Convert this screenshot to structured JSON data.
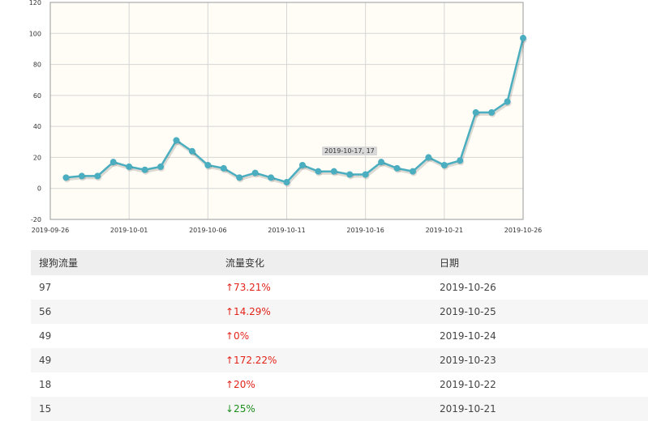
{
  "chart_data": {
    "type": "line",
    "x": [
      "2019-09-27",
      "2019-09-28",
      "2019-09-29",
      "2019-09-30",
      "2019-10-01",
      "2019-10-02",
      "2019-10-03",
      "2019-10-04",
      "2019-10-05",
      "2019-10-06",
      "2019-10-07",
      "2019-10-08",
      "2019-10-09",
      "2019-10-10",
      "2019-10-11",
      "2019-10-12",
      "2019-10-13",
      "2019-10-14",
      "2019-10-15",
      "2019-10-16",
      "2019-10-17",
      "2019-10-18",
      "2019-10-19",
      "2019-10-20",
      "2019-10-21",
      "2019-10-22",
      "2019-10-23",
      "2019-10-24",
      "2019-10-25",
      "2019-10-26"
    ],
    "series": [
      {
        "values": [
          7,
          8,
          8,
          17,
          14,
          12,
          14,
          31,
          24,
          15,
          13,
          7,
          10,
          7,
          4,
          15,
          11,
          11,
          9,
          9,
          17,
          13,
          11,
          20,
          15,
          18,
          49,
          49,
          56,
          97
        ]
      }
    ],
    "xticks": [
      "2019-09-26",
      "2019-10-01",
      "2019-10-06",
      "2019-10-11",
      "2019-10-16",
      "2019-10-21",
      "2019-10-26"
    ],
    "yticks": [
      -20,
      0,
      20,
      40,
      60,
      80,
      100,
      120
    ],
    "ylim": [
      -20,
      120
    ],
    "xlim": [
      "2019-09-26",
      "2019-10-26"
    ],
    "grid": true,
    "line_color": "#4aaec0",
    "plot_background": "#fffdf5",
    "tooltip": "2019-10-17, 17"
  },
  "table": {
    "headers": [
      "搜狗流量",
      "流量变化",
      "日期"
    ],
    "rows": [
      {
        "traffic": "97",
        "change": "↑73.21%",
        "date": "2019-10-26",
        "direction": "up"
      },
      {
        "traffic": "56",
        "change": "↑14.29%",
        "date": "2019-10-25",
        "direction": "up"
      },
      {
        "traffic": "49",
        "change": "↑0%",
        "date": "2019-10-24",
        "direction": "up"
      },
      {
        "traffic": "49",
        "change": "↑172.22%",
        "date": "2019-10-23",
        "direction": "up"
      },
      {
        "traffic": "18",
        "change": "↑20%",
        "date": "2019-10-22",
        "direction": "up"
      },
      {
        "traffic": "15",
        "change": "↓25%",
        "date": "2019-10-21",
        "direction": "down"
      }
    ]
  }
}
